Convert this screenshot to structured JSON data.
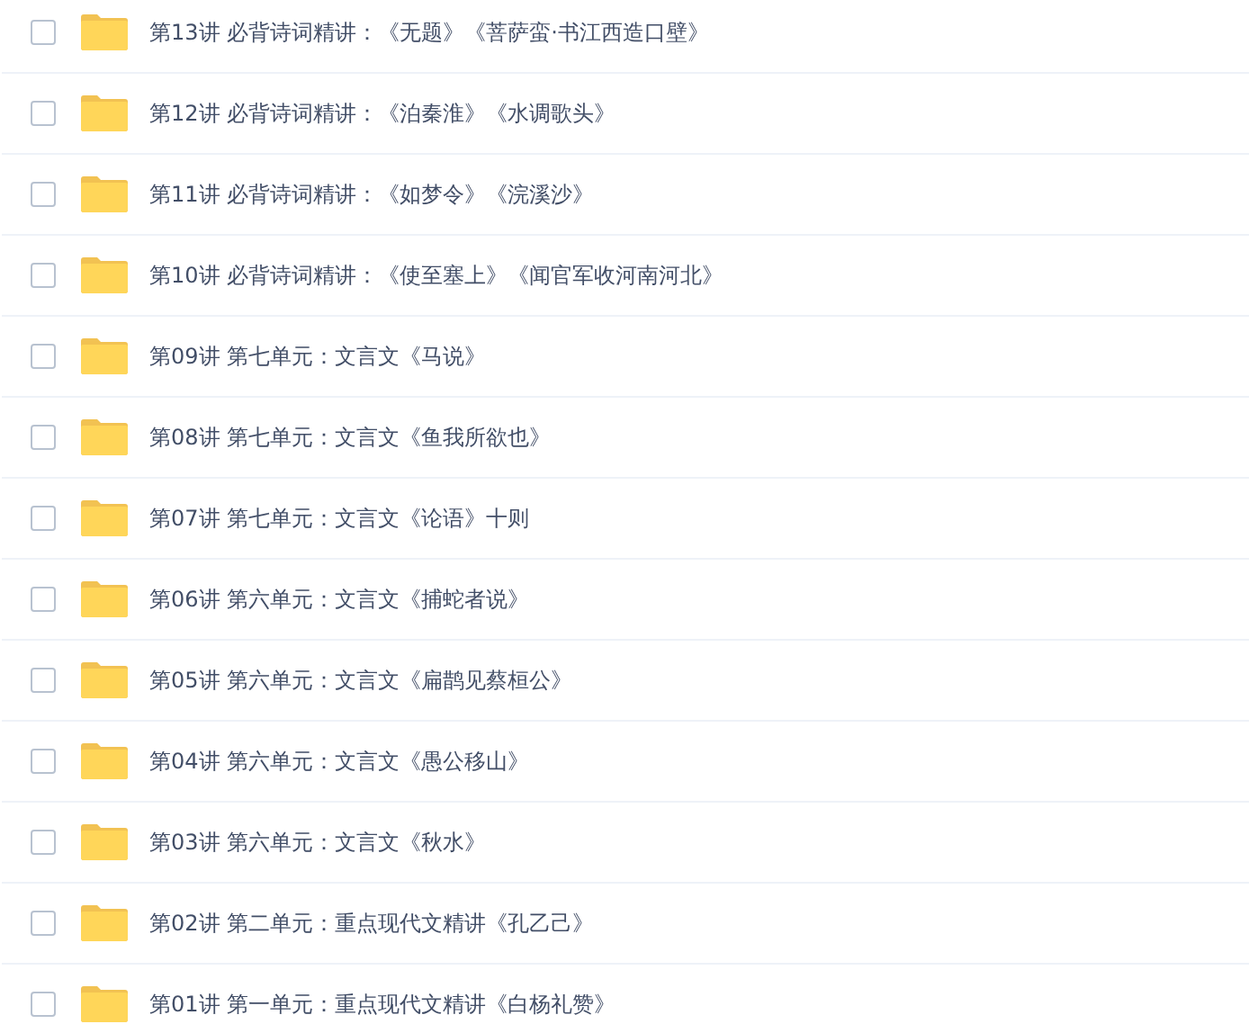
{
  "folders": [
    {
      "name": "第13讲 必背诗词精讲：《无题》《菩萨蛮·书江西造口壁》",
      "checked": false
    },
    {
      "name": "第12讲 必背诗词精讲：《泊秦淮》《水调歌头》",
      "checked": false
    },
    {
      "name": "第11讲 必背诗词精讲：《如梦令》《浣溪沙》",
      "checked": false
    },
    {
      "name": "第10讲 必背诗词精讲：《使至塞上》《闻官军收河南河北》",
      "checked": false
    },
    {
      "name": "第09讲 第七单元：文言文《马说》",
      "checked": false
    },
    {
      "name": "第08讲 第七单元：文言文《鱼我所欲也》",
      "checked": false
    },
    {
      "name": "第07讲 第七单元：文言文《论语》十则",
      "checked": false
    },
    {
      "name": "第06讲 第六单元：文言文《捕蛇者说》",
      "checked": false
    },
    {
      "name": "第05讲 第六单元：文言文《扁鹊见蔡桓公》",
      "checked": false
    },
    {
      "name": "第04讲 第六单元：文言文《愚公移山》",
      "checked": false
    },
    {
      "name": "第03讲 第六单元：文言文《秋水》",
      "checked": false
    },
    {
      "name": "第02讲 第二单元：重点现代文精讲《孔乙己》",
      "checked": false
    },
    {
      "name": "第01讲 第一单元：重点现代文精讲《白杨礼赞》",
      "checked": false
    }
  ]
}
